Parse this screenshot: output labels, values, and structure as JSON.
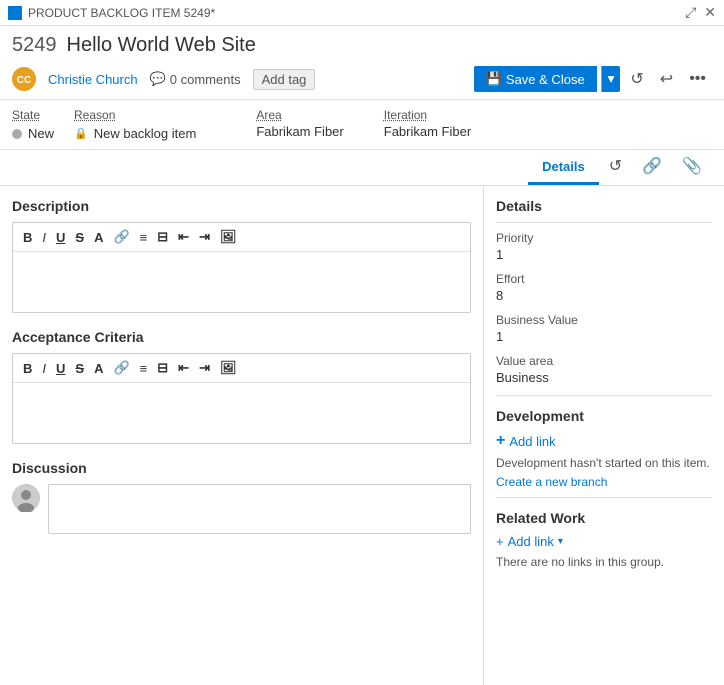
{
  "titleBar": {
    "icon": "■",
    "title": "PRODUCT BACKLOG ITEM 5249*",
    "expand": "⤢",
    "close": "✕"
  },
  "item": {
    "number": "5249",
    "title": "Hello World Web Site"
  },
  "user": {
    "name": "Christie Church",
    "initials": "CC"
  },
  "comments": {
    "count": "0 comments"
  },
  "buttons": {
    "addTag": "Add tag",
    "saveClose": "Save & Close"
  },
  "fields": {
    "stateLabel": "State",
    "stateValue": "New",
    "reasonLabel": "Reason",
    "reasonValue": "New backlog item",
    "areaLabel": "Area",
    "areaValue": "Fabrikam Fiber",
    "iterationLabel": "Iteration",
    "iterationValue": "Fabrikam Fiber"
  },
  "tabs": [
    {
      "id": "details",
      "label": "Details",
      "active": true
    },
    {
      "id": "history",
      "label": "⟳"
    },
    {
      "id": "links",
      "label": "🔗"
    },
    {
      "id": "attachments",
      "label": "📎"
    }
  ],
  "sections": {
    "description": "Description",
    "acceptanceCriteria": "Acceptance Criteria",
    "discussion": "Discussion"
  },
  "toolbar": {
    "bold": "B",
    "italic": "I",
    "underline": "U",
    "strikethrough": "S",
    "highlight": "A",
    "link": "🔗",
    "bulletList": "≡",
    "numberedList": "≡",
    "decreaseIndent": "⇐",
    "increaseIndent": "⇒",
    "image": "🖼"
  },
  "details": {
    "title": "Details",
    "priority": {
      "label": "Priority",
      "value": "1"
    },
    "effort": {
      "label": "Effort",
      "value": "8"
    },
    "businessValue": {
      "label": "Business Value",
      "value": "1"
    },
    "valueArea": {
      "label": "Value area",
      "value": "Business"
    }
  },
  "development": {
    "title": "Development",
    "addLinkLabel": "+ Add link",
    "text": "Development hasn't started on this item.",
    "branchLink": "Create a new branch"
  },
  "relatedWork": {
    "title": "Related Work",
    "addLinkLabel": "+ Add link",
    "noLinksText": "There are no links in this group."
  }
}
